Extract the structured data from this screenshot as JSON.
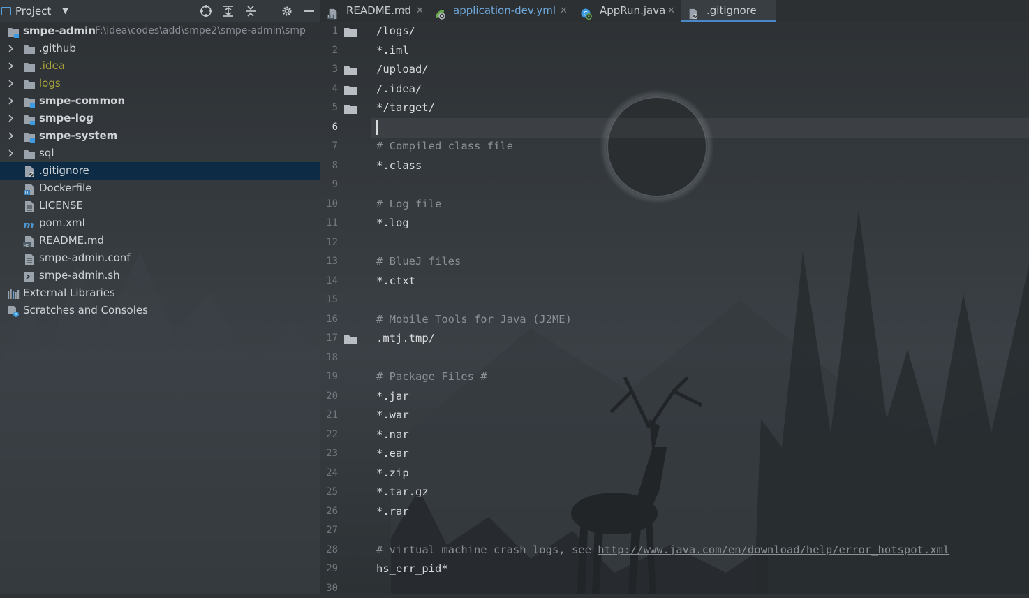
{
  "project_panel": {
    "title": "Project",
    "tree": [
      {
        "label": "smpe-admin",
        "path": "F:\\idea\\codes\\add\\smpe2\\smpe-admin\\smp",
        "icon": "module-folder-icon",
        "style": "bold"
      },
      {
        "label": ".github",
        "icon": "folder-icon",
        "style": "normal"
      },
      {
        "label": ".idea",
        "icon": "folder-icon",
        "style": "olive"
      },
      {
        "label": "logs",
        "icon": "folder-icon",
        "style": "olive"
      },
      {
        "label": "smpe-common",
        "icon": "module-folder-icon",
        "style": "bold"
      },
      {
        "label": "smpe-log",
        "icon": "module-folder-icon",
        "style": "bold"
      },
      {
        "label": "smpe-system",
        "icon": "module-folder-icon",
        "style": "bold"
      },
      {
        "label": "sql",
        "icon": "folder-icon",
        "style": "normal"
      },
      {
        "label": ".gitignore",
        "icon": "gitignore-file-icon",
        "style": "normal"
      },
      {
        "label": "Dockerfile",
        "icon": "docker-file-icon",
        "style": "normal"
      },
      {
        "label": "LICENSE",
        "icon": "text-file-icon",
        "style": "normal"
      },
      {
        "label": "pom.xml",
        "icon": "maven-file-icon",
        "style": "normal"
      },
      {
        "label": "README.md",
        "icon": "markdown-file-icon",
        "style": "normal"
      },
      {
        "label": "smpe-admin.conf",
        "icon": "text-file-icon",
        "style": "normal"
      },
      {
        "label": "smpe-admin.sh",
        "icon": "shell-script-icon",
        "style": "normal"
      },
      {
        "label": "External Libraries",
        "icon": "library-icon",
        "style": "normal"
      },
      {
        "label": "Scratches and Consoles",
        "icon": "scratches-icon",
        "style": "normal"
      }
    ],
    "selected_item": ".gitignore"
  },
  "tabs": [
    {
      "label": "README.md",
      "icon": "markdown-file-icon",
      "active": false
    },
    {
      "label": "application-dev.yml",
      "icon": "yaml-config-icon",
      "active": false
    },
    {
      "label": "AppRun.java",
      "icon": "java-class-icon",
      "active": false
    },
    {
      "label": ".gitignore",
      "icon": "gitignore-file-icon",
      "active": true
    }
  ],
  "tab_close_glyph": "✕",
  "editor": {
    "file": ".gitignore",
    "current_line": 6,
    "lines": [
      {
        "n": "1",
        "text": "/logs/",
        "type": "code",
        "folder": true
      },
      {
        "n": "2",
        "text": "*.iml",
        "type": "code",
        "folder": false
      },
      {
        "n": "3",
        "text": "/upload/",
        "type": "code",
        "folder": true
      },
      {
        "n": "4",
        "text": "/.idea/",
        "type": "code",
        "folder": true
      },
      {
        "n": "5",
        "text": "*/target/",
        "type": "code",
        "folder": true
      },
      {
        "n": "6",
        "text": "",
        "type": "code",
        "folder": false
      },
      {
        "n": "7",
        "text": "# Compiled class file",
        "type": "comment",
        "folder": false
      },
      {
        "n": "8",
        "text": "*.class",
        "type": "code",
        "folder": false
      },
      {
        "n": "9",
        "text": "",
        "type": "code",
        "folder": false
      },
      {
        "n": "10",
        "text": "# Log file",
        "type": "comment",
        "folder": false
      },
      {
        "n": "11",
        "text": "*.log",
        "type": "code",
        "folder": false
      },
      {
        "n": "12",
        "text": "",
        "type": "code",
        "folder": false
      },
      {
        "n": "13",
        "text": "# BlueJ files",
        "type": "comment",
        "folder": false
      },
      {
        "n": "14",
        "text": "*.ctxt",
        "type": "code",
        "folder": false
      },
      {
        "n": "15",
        "text": "",
        "type": "code",
        "folder": false
      },
      {
        "n": "16",
        "text": "# Mobile Tools for Java (J2ME)",
        "type": "comment",
        "folder": false
      },
      {
        "n": "17",
        "text": ".mtj.tmp/",
        "type": "code",
        "folder": true
      },
      {
        "n": "18",
        "text": "",
        "type": "code",
        "folder": false
      },
      {
        "n": "19",
        "text": "# Package Files #",
        "type": "comment",
        "folder": false
      },
      {
        "n": "20",
        "text": "*.jar",
        "type": "code",
        "folder": false
      },
      {
        "n": "21",
        "text": "*.war",
        "type": "code",
        "folder": false
      },
      {
        "n": "22",
        "text": "*.nar",
        "type": "code",
        "folder": false
      },
      {
        "n": "23",
        "text": "*.ear",
        "type": "code",
        "folder": false
      },
      {
        "n": "24",
        "text": "*.zip",
        "type": "code",
        "folder": false
      },
      {
        "n": "25",
        "text": "*.tar.gz",
        "type": "code",
        "folder": false
      },
      {
        "n": "26",
        "text": "*.rar",
        "type": "code",
        "folder": false
      },
      {
        "n": "27",
        "text": "",
        "type": "code",
        "folder": false
      },
      {
        "n": "28",
        "text": "# virtual machine crash logs, see ",
        "type": "comment",
        "folder": false,
        "link": "http://www.java.com/en/download/help/error_hotspot.xml"
      },
      {
        "n": "29",
        "text": "hs_err_pid*",
        "type": "code",
        "folder": false
      },
      {
        "n": "30",
        "text": "",
        "type": "code",
        "folder": false
      }
    ]
  },
  "colors": {
    "background": "#2f3336",
    "selection": "#0d2b45",
    "accent": "#4a88c7",
    "comment": "#8a9096",
    "text": "#d8dadc",
    "olive": "#a6a03c"
  }
}
